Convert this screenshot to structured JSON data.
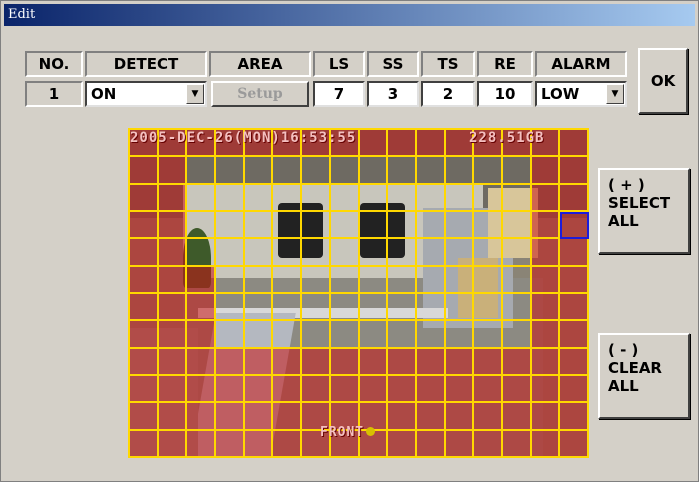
{
  "window": {
    "title": "Edit"
  },
  "columns": [
    {
      "key": "no",
      "label": "NO."
    },
    {
      "key": "detect",
      "label": "DETECT"
    },
    {
      "key": "area",
      "label": "AREA"
    },
    {
      "key": "ls",
      "label": "LS"
    },
    {
      "key": "ss",
      "label": "SS"
    },
    {
      "key": "ts",
      "label": "TS"
    },
    {
      "key": "re",
      "label": "RE"
    },
    {
      "key": "alarm",
      "label": "ALARM"
    }
  ],
  "row": {
    "no": "1",
    "detect": "ON",
    "area_button": "Setup",
    "ls": "7",
    "ss": "3",
    "ts": "2",
    "re": "10",
    "alarm": "LOW"
  },
  "buttons": {
    "ok": "OK",
    "select_all": [
      "( + )",
      "SELECT",
      "ALL"
    ],
    "clear_all": [
      "( - )",
      "CLEAR",
      "ALL"
    ]
  },
  "video": {
    "osd_timestamp": "2005-DEC-26(MON)16:53:55",
    "osd_storage": "228.5",
    "osd_storage_unit": "1GB",
    "osd_camera": "FRONT",
    "grid": {
      "cols": 16,
      "rows": 12
    }
  },
  "colors": {
    "grid_line": "#ffd800",
    "detect_cell": "#c81414",
    "selected_cell": "#1c1cdc",
    "titlebar_start": "#0a246a",
    "titlebar_end": "#a6caf0"
  }
}
